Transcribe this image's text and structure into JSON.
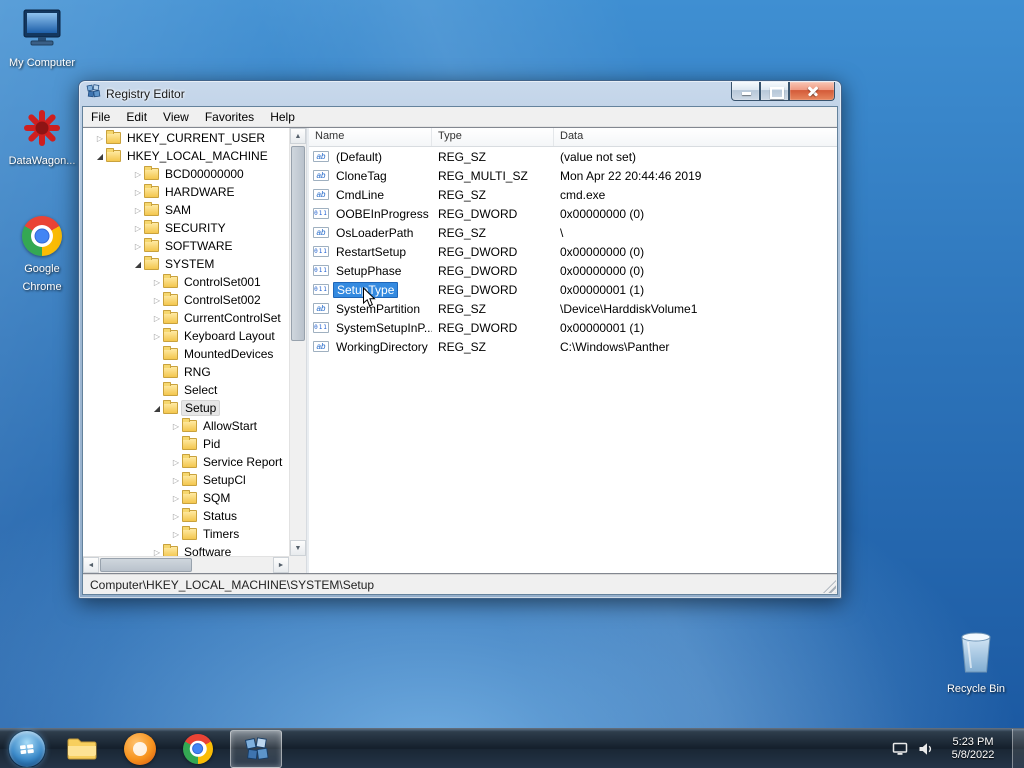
{
  "desktop_icons": [
    {
      "label": "My Computer",
      "icon": "my-computer-icon"
    },
    {
      "label": "DataWagon...",
      "icon": "datawagon-icon"
    },
    {
      "label": "Google Chrome",
      "icon": "chrome-icon"
    },
    {
      "label": "Recycle Bin",
      "icon": "recycle-bin-icon"
    }
  ],
  "registry_window": {
    "title": "Registry Editor",
    "menus": [
      "File",
      "Edit",
      "View",
      "Favorites",
      "Help"
    ],
    "tree_items": [
      {
        "label": "HKEY_CURRENT_USER",
        "level": 1,
        "state": "collapsed"
      },
      {
        "label": "HKEY_LOCAL_MACHINE",
        "level": 1,
        "state": "expanded"
      },
      {
        "label": "BCD00000000",
        "level": 3,
        "state": "collapsed"
      },
      {
        "label": "HARDWARE",
        "level": 3,
        "state": "collapsed"
      },
      {
        "label": "SAM",
        "level": 3,
        "state": "collapsed"
      },
      {
        "label": "SECURITY",
        "level": 3,
        "state": "collapsed"
      },
      {
        "label": "SOFTWARE",
        "level": 3,
        "state": "collapsed"
      },
      {
        "label": "SYSTEM",
        "level": 3,
        "state": "expanded"
      },
      {
        "label": "ControlSet001",
        "level": 4,
        "state": "collapsed"
      },
      {
        "label": "ControlSet002",
        "level": 4,
        "state": "collapsed"
      },
      {
        "label": "CurrentControlSet",
        "level": 4,
        "state": "collapsed"
      },
      {
        "label": "Keyboard Layout",
        "level": 4,
        "state": "collapsed"
      },
      {
        "label": "MountedDevices",
        "level": 4,
        "state": "none"
      },
      {
        "label": "RNG",
        "level": 4,
        "state": "none"
      },
      {
        "label": "Select",
        "level": 4,
        "state": "none"
      },
      {
        "label": "Setup",
        "level": 4,
        "state": "expanded",
        "selected": true
      },
      {
        "label": "AllowStart",
        "level": 5,
        "state": "collapsed"
      },
      {
        "label": "Pid",
        "level": 5,
        "state": "none"
      },
      {
        "label": "Service Report",
        "level": 5,
        "state": "collapsed"
      },
      {
        "label": "SetupCl",
        "level": 5,
        "state": "collapsed"
      },
      {
        "label": "SQM",
        "level": 5,
        "state": "collapsed"
      },
      {
        "label": "Status",
        "level": 5,
        "state": "collapsed"
      },
      {
        "label": "Timers",
        "level": 5,
        "state": "collapsed"
      },
      {
        "label": "Software",
        "level": 4,
        "state": "collapsed"
      }
    ],
    "list": {
      "columns": [
        "Name",
        "Type",
        "Data"
      ],
      "icon_glyphs": {
        "string": "ab",
        "dword": "011"
      },
      "rows": [
        {
          "name": "(Default)",
          "icon": "string",
          "type": "REG_SZ",
          "data": "(value not set)"
        },
        {
          "name": "CloneTag",
          "icon": "string",
          "type": "REG_MULTI_SZ",
          "data": "Mon Apr 22 20:44:46 2019"
        },
        {
          "name": "CmdLine",
          "icon": "string",
          "type": "REG_SZ",
          "data": "cmd.exe"
        },
        {
          "name": "OOBEInProgress",
          "icon": "dword",
          "type": "REG_DWORD",
          "data": "0x00000000 (0)"
        },
        {
          "name": "OsLoaderPath",
          "icon": "string",
          "type": "REG_SZ",
          "data": "\\"
        },
        {
          "name": "RestartSetup",
          "icon": "dword",
          "type": "REG_DWORD",
          "data": "0x00000000 (0)"
        },
        {
          "name": "SetupPhase",
          "icon": "dword",
          "type": "REG_DWORD",
          "data": "0x00000000 (0)"
        },
        {
          "name": "SetupType",
          "icon": "dword",
          "type": "REG_DWORD",
          "data": "0x00000001 (1)",
          "selected": true
        },
        {
          "name": "SystemPartition",
          "icon": "string",
          "type": "REG_SZ",
          "data": "\\Device\\HarddiskVolume1"
        },
        {
          "name": "SystemSetupInP...",
          "icon": "dword",
          "type": "REG_DWORD",
          "data": "0x00000001 (1)"
        },
        {
          "name": "WorkingDirectory",
          "icon": "string",
          "type": "REG_SZ",
          "data": "C:\\Windows\\Panther"
        }
      ]
    },
    "status_bar": "Computer\\HKEY_LOCAL_MACHINE\\SYSTEM\\Setup"
  },
  "taskbar": {
    "buttons": [
      {
        "icon": "start-orb-icon"
      },
      {
        "icon": "explorer-folder-icon"
      },
      {
        "icon": "orange-app-icon"
      },
      {
        "icon": "chrome-icon"
      },
      {
        "icon": "registry-editor-icon",
        "active": true
      }
    ],
    "tray": {
      "icons": [
        "network-icon",
        "volume-icon"
      ],
      "time": "5:23 PM",
      "date": "5/8/2022"
    }
  }
}
